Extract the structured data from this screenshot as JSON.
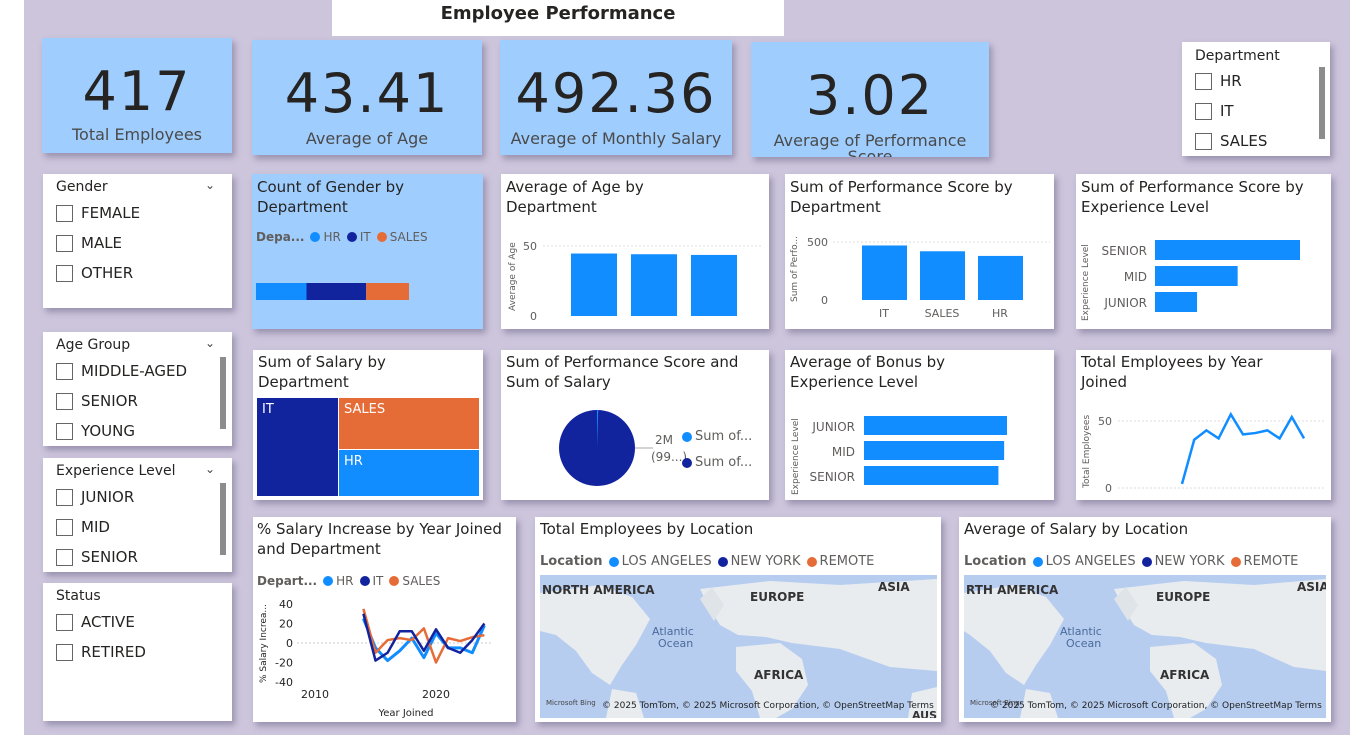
{
  "page_title": "Employee Performance",
  "kpis": [
    {
      "value": "417",
      "label": "Total Employees"
    },
    {
      "value": "43.41",
      "label": "Average of Age"
    },
    {
      "value": "492.36",
      "label": "Average of Monthly Salary"
    },
    {
      "value": "3.02",
      "label": "Average of Performance Score"
    }
  ],
  "slicers": {
    "department": {
      "header": "Department",
      "items": [
        "HR",
        "IT",
        "SALES"
      ]
    },
    "gender": {
      "header": "Gender",
      "items": [
        "FEMALE",
        "MALE",
        "OTHER"
      ]
    },
    "age_group": {
      "header": "Age Group",
      "items": [
        "MIDDLE-AGED",
        "SENIOR",
        "YOUNG"
      ]
    },
    "experience": {
      "header": "Experience Level",
      "items": [
        "JUNIOR",
        "MID",
        "SENIOR"
      ]
    },
    "status": {
      "header": "Status",
      "items": [
        "ACTIVE",
        "RETIRED"
      ]
    }
  },
  "colors": {
    "hr": "#118dff",
    "it": "#12239e",
    "sales": "#e66c37",
    "kpi_bg": "#9fcdfe",
    "page_bg": "#ccc5dc"
  },
  "visuals": {
    "gender_by_dept": {
      "title": "Count of Gender by Department",
      "legend_title": "Depa...",
      "legend": [
        "HR",
        "IT",
        "SALES"
      ]
    },
    "age_by_dept": {
      "title": "Average of Age by Department",
      "ylabel": "Average of Age",
      "ticks": [
        "50",
        "0"
      ]
    },
    "perf_by_dept": {
      "title": "Sum of Performance Score by Department",
      "ylabel": "Sum of Perfo...",
      "ticks": [
        "500",
        "0"
      ]
    },
    "perf_by_exp": {
      "title": "Sum of Performance Score by Experience Level",
      "ylabel": "Experience Level"
    },
    "salary_by_dept": {
      "title": "Sum of Salary by Department"
    },
    "perf_and_salary": {
      "title": "Sum of Performance Score and Sum of Salary",
      "data_label_1": "2M",
      "data_label_2": "(99...)",
      "legend": [
        "Sum of...",
        "Sum of..."
      ]
    },
    "bonus_by_exp": {
      "title": "Average of Bonus by Experience Level",
      "ylabel": "Experience Level"
    },
    "emp_by_year": {
      "title": "Total Employees by Year Joined",
      "ylabel": "Total Employees",
      "ticks": [
        "50",
        "0"
      ]
    },
    "salary_increase": {
      "title": "% Salary Increase by Year Joined and Department",
      "legend_title": "Depart...",
      "legend": [
        "HR",
        "IT",
        "SALES"
      ],
      "ylabel": "% Salary Increa...",
      "xlabel": "Year Joined",
      "yticks": [
        "40",
        "20",
        "0",
        "-20",
        "-40"
      ],
      "xticks": [
        "2010",
        "2020"
      ]
    },
    "emp_by_location": {
      "title": "Total Employees by Location",
      "legend_title": "Location",
      "legend": [
        "LOS ANGELES",
        "NEW YORK",
        "REMOTE"
      ]
    },
    "salary_by_location": {
      "title": "Average of Salary by Location",
      "legend_title": "Location",
      "legend": [
        "LOS ANGELES",
        "NEW YORK",
        "REMOTE"
      ]
    }
  },
  "map_labels": {
    "north_america": "NORTH AMERICA",
    "north_america_cut": "RTH AMERICA",
    "europe": "EUROPE",
    "asia": "ASIA",
    "atlantic": "Atlantic",
    "ocean": "Ocean",
    "africa": "AFRICA",
    "aus": "AUS",
    "attribution": "© 2025 TomTom, © 2025 Microsoft Corporation, © OpenStreetMap  Terms",
    "bing": "Microsoft Bing"
  },
  "chart_data": [
    {
      "type": "bar",
      "title": "Count of Gender by Department",
      "stacked_horizontal": true,
      "categories": [
        "HR",
        "IT",
        "SALES"
      ],
      "values": [
        0.33,
        0.39,
        0.28
      ]
    },
    {
      "type": "bar",
      "title": "Average of Age by Department",
      "categories": [
        "",
        "",
        ""
      ],
      "values": [
        44,
        43.5,
        43
      ],
      "ylim": [
        0,
        55
      ]
    },
    {
      "type": "bar",
      "title": "Sum of Performance Score by Department",
      "categories": [
        "IT",
        "SALES",
        "HR"
      ],
      "values": [
        470,
        420,
        380
      ],
      "ylim": [
        0,
        600
      ]
    },
    {
      "type": "bar",
      "orientation": "horizontal",
      "title": "Sum of Performance Score by Experience Level",
      "categories": [
        "SENIOR",
        "MID",
        "JUNIOR"
      ],
      "values": [
        1.0,
        0.57,
        0.29
      ]
    },
    {
      "type": "bar",
      "orientation": "horizontal",
      "title": "Average of Bonus by Experience Level",
      "categories": [
        "JUNIOR",
        "MID",
        "SENIOR"
      ],
      "values": [
        1.0,
        0.98,
        0.94
      ]
    },
    {
      "type": "line",
      "title": "Total Employees by Year Joined",
      "values": [
        3,
        36,
        43,
        37,
        55,
        40,
        41,
        43,
        37,
        53,
        37
      ],
      "ylim": [
        0,
        60
      ]
    },
    {
      "type": "line",
      "title": "% Salary Increase by Year Joined and Department",
      "x": [
        2014,
        2015,
        2016,
        2017,
        2018,
        2019,
        2020,
        2021,
        2022,
        2023,
        2024
      ],
      "series": [
        {
          "name": "HR",
          "values": [
            25,
            -5,
            -18,
            -8,
            5,
            -15,
            10,
            -5,
            -5,
            -10,
            18
          ]
        },
        {
          "name": "IT",
          "values": [
            30,
            -18,
            -10,
            12,
            12,
            -8,
            14,
            -5,
            -10,
            3,
            20
          ]
        },
        {
          "name": "SALES",
          "values": [
            35,
            -10,
            3,
            5,
            3,
            15,
            -20,
            5,
            2,
            6,
            8
          ]
        }
      ],
      "ylim": [
        -40,
        40
      ]
    },
    {
      "type": "pie",
      "title": "Sum of Performance Score and Sum of Salary",
      "values": [
        0.995,
        0.005
      ]
    }
  ]
}
